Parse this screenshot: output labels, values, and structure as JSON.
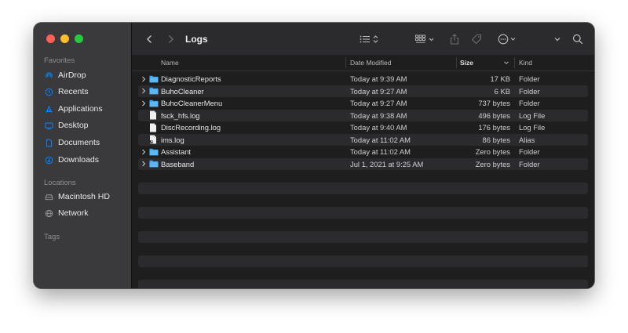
{
  "window": {
    "title": "Logs"
  },
  "sidebar": {
    "favorites_label": "Favorites",
    "favorites": [
      {
        "label": "AirDrop",
        "icon": "airdrop-icon"
      },
      {
        "label": "Recents",
        "icon": "clock-icon"
      },
      {
        "label": "Applications",
        "icon": "applications-icon"
      },
      {
        "label": "Desktop",
        "icon": "desktop-icon"
      },
      {
        "label": "Documents",
        "icon": "document-icon"
      },
      {
        "label": "Downloads",
        "icon": "download-icon"
      }
    ],
    "locations_label": "Locations",
    "locations": [
      {
        "label": "Macintosh HD",
        "icon": "drive-icon"
      },
      {
        "label": "Network",
        "icon": "globe-icon"
      }
    ],
    "tags_label": "Tags"
  },
  "toolbar": {
    "back_icon": "chevron-left-icon",
    "forward_icon": "chevron-right-icon",
    "view_list_icon": "list-view-icon",
    "group_icon": "grid-view-icon",
    "share_icon": "share-icon",
    "tag_icon": "tag-icon",
    "more_icon": "ellipsis-circle-icon",
    "search_icon": "search-icon"
  },
  "columns": {
    "name": "Name",
    "date": "Date Modified",
    "size": "Size",
    "kind": "Kind"
  },
  "files": [
    {
      "name": "DiagnosticReports",
      "date": "Today at 9:39 AM",
      "size": "17 KB",
      "kind": "Folder",
      "type": "folder",
      "expandable": true
    },
    {
      "name": "BuhoCleaner",
      "date": "Today at 9:27 AM",
      "size": "6 KB",
      "kind": "Folder",
      "type": "folder",
      "expandable": true
    },
    {
      "name": "BuhoCleanerMenu",
      "date": "Today at 9:27 AM",
      "size": "737 bytes",
      "kind": "Folder",
      "type": "folder",
      "expandable": true
    },
    {
      "name": "fsck_hfs.log",
      "date": "Today at 9:38 AM",
      "size": "496 bytes",
      "kind": "Log File",
      "type": "file",
      "expandable": false
    },
    {
      "name": "DiscRecording.log",
      "date": "Today at 9:40 AM",
      "size": "176 bytes",
      "kind": "Log File",
      "type": "file",
      "expandable": false
    },
    {
      "name": "ims.log",
      "date": "Today at 11:02 AM",
      "size": "86 bytes",
      "kind": "Alias",
      "type": "alias",
      "expandable": false
    },
    {
      "name": "Assistant",
      "date": "Today at 11:02 AM",
      "size": "Zero bytes",
      "kind": "Folder",
      "type": "folder",
      "expandable": true
    },
    {
      "name": "Baseband",
      "date": "Jul 1, 2021 at 9:25 AM",
      "size": "Zero bytes",
      "kind": "Folder",
      "type": "folder",
      "expandable": true
    }
  ],
  "colors": {
    "folder": "#3fa6f1",
    "accent": "#0a84ff"
  }
}
